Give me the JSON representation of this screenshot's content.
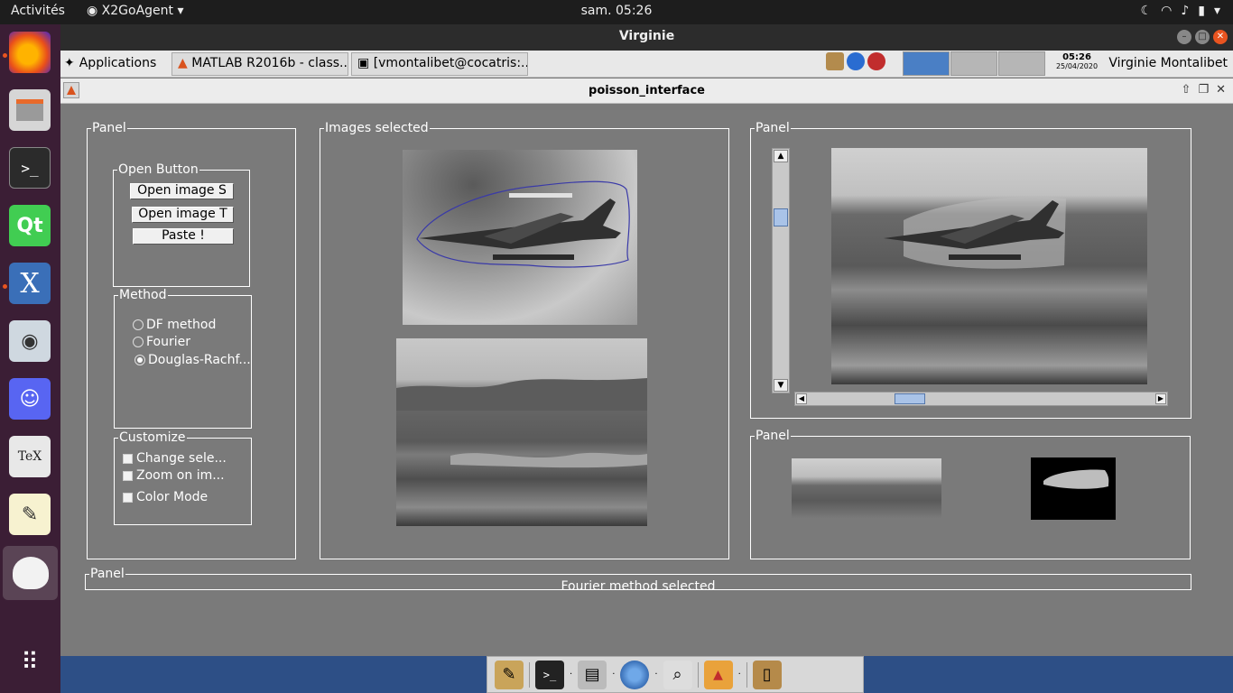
{
  "topbar": {
    "activities": "Activités",
    "app_menu": "X2GoAgent",
    "clock": "sam. 05:26"
  },
  "window": {
    "title": "Virginie"
  },
  "xpanel": {
    "applications": "Applications",
    "tasks": [
      "MATLAB R2016b - class...",
      "[vmontalibet@cocatris:..."
    ],
    "clock_time": "05:26",
    "clock_date": "25/04/2020",
    "user": "Virginie Montalibet"
  },
  "figure": {
    "title": "poisson_interface",
    "left_panel": {
      "title": "Panel",
      "open_group": {
        "title": "Open Button",
        "buttons": [
          "Open image S",
          "Open image T",
          "Paste !"
        ]
      },
      "method_group": {
        "title": "Method",
        "options": [
          "DF method",
          "Fourier",
          "Douglas-Rachf..."
        ],
        "selected_index": 2
      },
      "customize_group": {
        "title": "Customize",
        "checkboxes": [
          "Change sele...",
          "Zoom on im...",
          "Color Mode"
        ]
      }
    },
    "images_panel": {
      "title": "Images selected"
    },
    "result_panel": {
      "title": "Panel"
    },
    "thumbs_panel": {
      "title": "Panel"
    },
    "status_panel": {
      "title": "Panel",
      "text": "Fourier method selected"
    }
  },
  "colors": {
    "figure_bg": "#7a7a7a",
    "dock_bg": "#3b1e35",
    "accent_close": "#e95420"
  }
}
